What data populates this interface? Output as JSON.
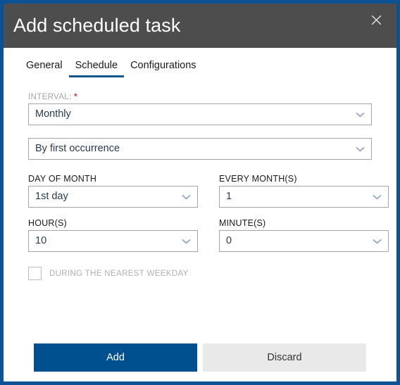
{
  "window": {
    "title": "Add scheduled task",
    "close_icon": "close-icon",
    "border_color": "#0b5394",
    "titlebar_color": "#4d4d4d"
  },
  "tabs": [
    {
      "label": "General",
      "active": false
    },
    {
      "label": "Schedule",
      "active": true
    },
    {
      "label": "Configurations",
      "active": false
    }
  ],
  "form": {
    "interval": {
      "label": "INTERVAL:",
      "required_marker": "*",
      "value": "Monthly",
      "chevron_icon": "chevron-down-icon"
    },
    "occurrence": {
      "value": "By first occurrence",
      "chevron_icon": "chevron-down-icon"
    },
    "day_of_month": {
      "label": "DAY OF MONTH",
      "value": "1st day",
      "chevron_icon": "chevron-down-icon"
    },
    "every_months": {
      "label": "EVERY MONTH(S)",
      "value": "1",
      "chevron_icon": "chevron-down-icon"
    },
    "hours": {
      "label": "HOUR(S)",
      "value": "10",
      "chevron_icon": "chevron-down-icon"
    },
    "minutes": {
      "label": "MINUTE(S)",
      "value": "0",
      "chevron_icon": "chevron-down-icon"
    },
    "nearest_weekday": {
      "label": "DURING THE NEAREST WEEKDAY",
      "checked": false
    }
  },
  "footer": {
    "add_label": "Add",
    "discard_label": "Discard",
    "add_color": "#00508f",
    "discard_color": "#e9e9e9"
  }
}
